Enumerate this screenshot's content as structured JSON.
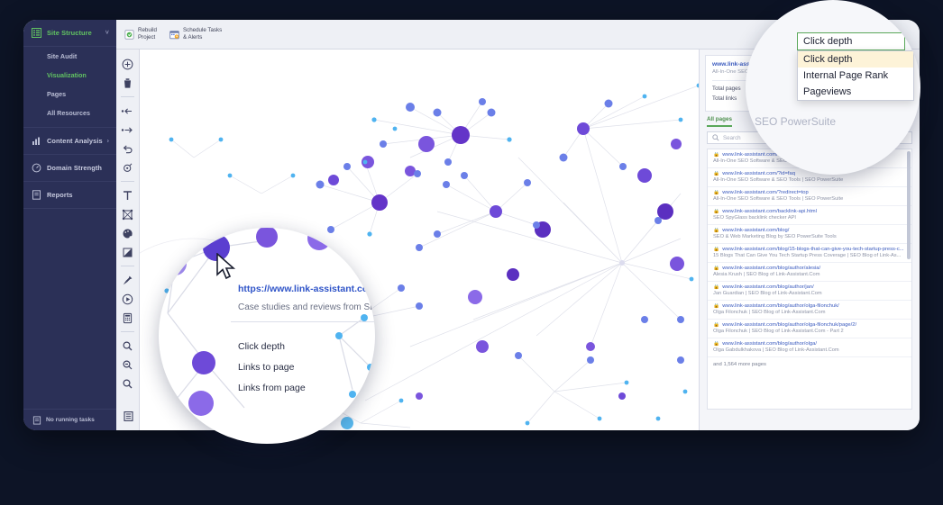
{
  "sidebar": {
    "sections": [
      {
        "label": "Site Structure",
        "icon": "list-icon",
        "active": true,
        "chevron": "˅"
      },
      {
        "label": "Content Analysis",
        "icon": "bar-chart-icon",
        "active": false,
        "chevron": "›"
      },
      {
        "label": "Domain Strength",
        "icon": "gauge-icon",
        "active": false,
        "chevron": ""
      },
      {
        "label": "Reports",
        "icon": "document-icon",
        "active": false,
        "chevron": ""
      }
    ],
    "sub_items": [
      {
        "label": "Site Audit",
        "selected": false
      },
      {
        "label": "Visualization",
        "selected": true
      },
      {
        "label": "Pages",
        "selected": false
      },
      {
        "label": "All Resources",
        "selected": false
      }
    ],
    "status": {
      "label": "No running tasks",
      "icon": "tasks-icon"
    }
  },
  "toolbar": {
    "buttons": [
      {
        "label": "Rebuild\nProject",
        "icon": "rebuild-icon"
      },
      {
        "label": "Schedule Tasks\n& Alerts",
        "icon": "calendar-icon"
      }
    ]
  },
  "rail": {
    "icons": [
      "add-node-icon",
      "delete-icon",
      "step-back-icon",
      "step-forward-icon",
      "undo-icon",
      "target-icon",
      "text-icon",
      "node-graph-icon",
      "palette-icon",
      "contrast-icon",
      "pin-icon",
      "play-icon",
      "calculator-icon",
      "zoom-in-icon",
      "zoom-out-icon",
      "zoom-fit-icon"
    ],
    "bottom_icon": "list-view-icon"
  },
  "right_panel": {
    "site_url": "www.link-assistant.com",
    "site_title": "All-In-One SEO Software & SEO Tools | SEO PowerSuite",
    "stats": [
      {
        "label": "Total pages"
      },
      {
        "label": "Total links"
      }
    ],
    "tabs": [
      {
        "label": "All pages",
        "active": true
      }
    ],
    "search": {
      "placeholder": "Search",
      "icon": "search-icon",
      "value": ""
    },
    "rows": [
      {
        "url": "www.link-assistant.com/",
        "title": "All-In-One SEO Software & SEO Tools | SEO PowerSuite"
      },
      {
        "url": "www.link-assistant.com/?id=faq",
        "title": "All-In-One SEO Software & SEO Tools | SEO PowerSuite"
      },
      {
        "url": "www.link-assistant.com/?redirect=top",
        "title": "All-In-One SEO Software & SEO Tools | SEO PowerSuite"
      },
      {
        "url": "www.link-assistant.com/backlink-api.html",
        "title": "SEO SpyGlass backlink checker API"
      },
      {
        "url": "www.link-assistant.com/blog/",
        "title": "SEO & Web Marketing Blog by SEO PowerSuite Tools"
      },
      {
        "url": "www.link-assistant.com/blog/15-blogs-that-can-give-you-tech-startup-press-c...",
        "title": "15 Blogs That Can Give You Tech Startup Press Coverage | SEO Blog of Link-As..."
      },
      {
        "url": "www.link-assistant.com/blog/author/alesia/",
        "title": "Alesia Krush | SEO Blog of Link-Assistant.Com"
      },
      {
        "url": "www.link-assistant.com/blog/author/jan/",
        "title": "Jan Guardian | SEO Blog of Link-Assistant.Com"
      },
      {
        "url": "www.link-assistant.com/blog/author/olga-filonchuk/",
        "title": "Olga Filonchuk | SEO Blog of Link-Assistant.Com"
      },
      {
        "url": "www.link-assistant.com/blog/author/olga-filonchuk/page/2/",
        "title": "Olga Filonchuk | SEO Blog of Link-Assistant.Com - Part 2"
      },
      {
        "url": "www.link-assistant.com/blog/author/olga/",
        "title": "Olga Gabdulkhakova | SEO Blog of Link-Assistant.Com"
      }
    ],
    "more_label": "and 1,564 more pages",
    "lock_icon": "lock-icon"
  },
  "graph_tooltip": {
    "url": "https://www.link-assistant.com/c",
    "description": "Case studies and reviews from SE",
    "items": [
      {
        "label": "Click depth"
      },
      {
        "label": "Links to page"
      },
      {
        "label": "Links from page"
      }
    ],
    "cursor_icon": "cursor-arrow-icon"
  },
  "dropdown_magnifier": {
    "selected": "Click depth",
    "options": [
      {
        "label": "Click depth",
        "highlighted": true
      },
      {
        "label": "Internal Page Rank",
        "highlighted": false
      },
      {
        "label": "Pageviews",
        "highlighted": false
      }
    ],
    "watermark": "SEO PowerSuite",
    "download_icon": "download-icon"
  },
  "colors": {
    "accent_green": "#62c462",
    "sidebar_bg": "#2b3057",
    "page_bg": "#0d1426",
    "link_blue": "#3b5bbf",
    "node_purple": "#6B3FD4",
    "node_light_blue": "#4FC3F7"
  }
}
